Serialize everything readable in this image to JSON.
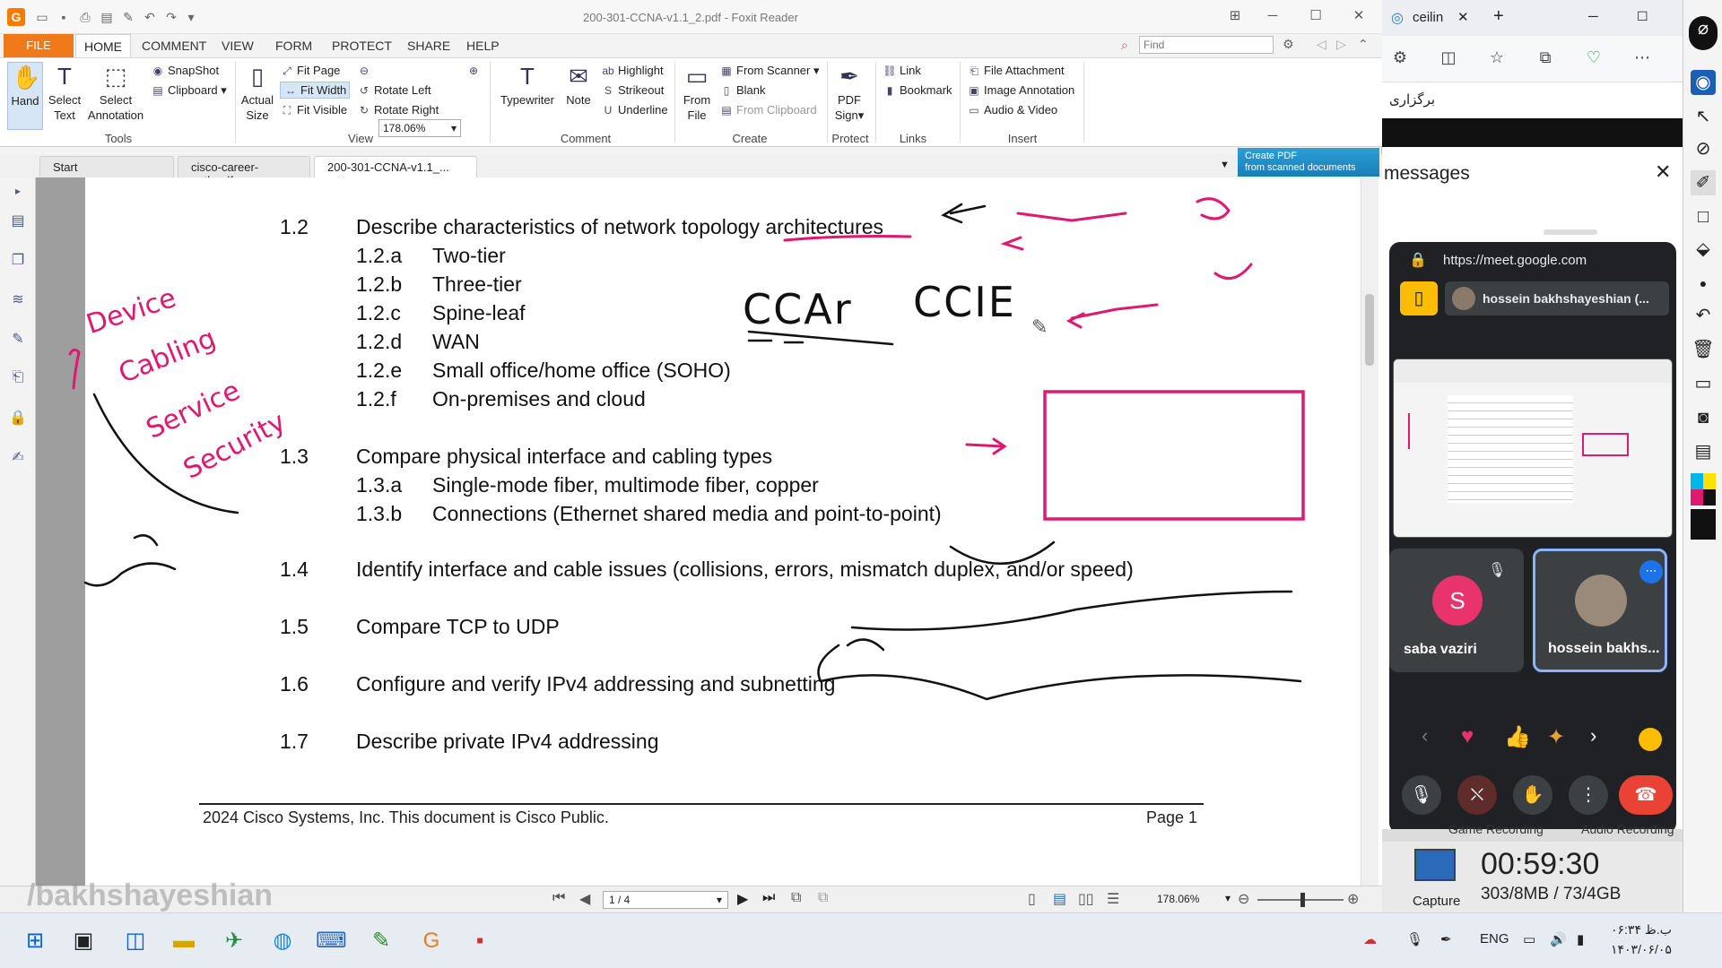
{
  "window": {
    "title": "200-301-CCNA-v1.1_2.pdf - Foxit Reader",
    "menu_tabs": [
      "FILE",
      "HOME",
      "COMMENT",
      "VIEW",
      "FORM",
      "PROTECT",
      "SHARE",
      "HELP"
    ],
    "find_placeholder": "Find"
  },
  "ribbon": {
    "tools": {
      "hand": "Hand",
      "select_text": "Select Text",
      "select_annotation": "Select Annotation",
      "snapshot": "SnapShot",
      "clipboard": "Clipboard",
      "group": "Tools"
    },
    "view": {
      "actual_size": "Actual Size",
      "fit_page": "Fit Page",
      "fit_width": "Fit Width",
      "fit_visible": "Fit Visible",
      "zoom": "178.06%",
      "rotate_left": "Rotate Left",
      "rotate_right": "Rotate Right",
      "group": "View"
    },
    "comment": {
      "typewriter": "Typewriter",
      "note": "Note",
      "highlight": "Highlight",
      "strikeout": "Strikeout",
      "underline": "Underline",
      "group": "Comment"
    },
    "create": {
      "from_file": "From File",
      "from_scanner": "From Scanner",
      "blank": "Blank",
      "from_clipboard": "From Clipboard",
      "group": "Create"
    },
    "protect": {
      "pdf_sign": "PDF Sign",
      "group": "Protect"
    },
    "links": {
      "link": "Link",
      "bookmark": "Bookmark",
      "group": "Links"
    },
    "insert": {
      "file_attachment": "File Attachment",
      "image_annotation": "Image Annotation",
      "audio_video": "Audio & Video",
      "group": "Insert"
    }
  },
  "doc_tabs": [
    "Start",
    "cisco-career-path.pdf",
    "200-301-CCNA-v1.1_..."
  ],
  "create_pdf": {
    "line1": "Create PDF",
    "line2": "from scanned documents"
  },
  "document": {
    "lines": [
      {
        "num": "1.2",
        "text": "Describe characteristics of network topology architectures"
      },
      {
        "num": "1.2.a",
        "text": "Two-tier"
      },
      {
        "num": "1.2.b",
        "text": "Three-tier"
      },
      {
        "num": "1.2.c",
        "text": "Spine-leaf"
      },
      {
        "num": "1.2.d",
        "text": "WAN"
      },
      {
        "num": "1.2.e",
        "text": "Small office/home office (SOHO)"
      },
      {
        "num": "1.2.f",
        "text": "On-premises and cloud"
      },
      {
        "num": "1.3",
        "text": "Compare physical interface and cabling types"
      },
      {
        "num": "1.3.a",
        "text": "Single-mode fiber, multimode fiber, copper"
      },
      {
        "num": "1.3.b",
        "text": "Connections (Ethernet shared media and point-to-point)"
      },
      {
        "num": "1.4",
        "text": "Identify interface and cable issues (collisions, errors, mismatch duplex, and/or speed)"
      },
      {
        "num": "1.5",
        "text": "Compare TCP to UDP"
      },
      {
        "num": "1.6",
        "text": "Configure and verify IPv4 addressing and subnetting"
      },
      {
        "num": "1.7",
        "text": "Describe private IPv4 addressing"
      }
    ],
    "footer_left": "2024 Cisco Systems, Inc. This document is Cisco Public.",
    "footer_right": "Page 1",
    "annotations": {
      "left_words": [
        "Device",
        "Cabling",
        "Service",
        "Security"
      ],
      "ccar": "CCAr",
      "ccie": "CCIE"
    }
  },
  "statusbar": {
    "page": "1 / 4",
    "zoom": "178.06%"
  },
  "watermark": "/bakhshayeshian",
  "browser": {
    "tab_title": "ceilin",
    "persian_text": "برگزاری",
    "panel_title": "messages",
    "url": "https://meet.google.com",
    "presenter": "hossein bakhshayeshian (...",
    "participants": [
      {
        "name": "saba vaziri",
        "initial": "S"
      },
      {
        "name": "hossein bakhs..."
      }
    ]
  },
  "recording": {
    "tabs": [
      "Game Recording",
      "Audio Recording"
    ],
    "capture": "Capture",
    "time": "00:59:30",
    "size": "303/8MB / 73/4GB"
  },
  "taskbar": {
    "lang": "ENG",
    "time": "۰۶:۳۴ ب.ظ",
    "date": "۱۴۰۳/۰۶/۰۵"
  },
  "colors": {
    "accent_orange": "#f07a1a",
    "ink_pink": "#e0186e",
    "meet_red": "#ea4335",
    "meet_bg": "#202124",
    "saba_avatar": "#e8336d"
  }
}
